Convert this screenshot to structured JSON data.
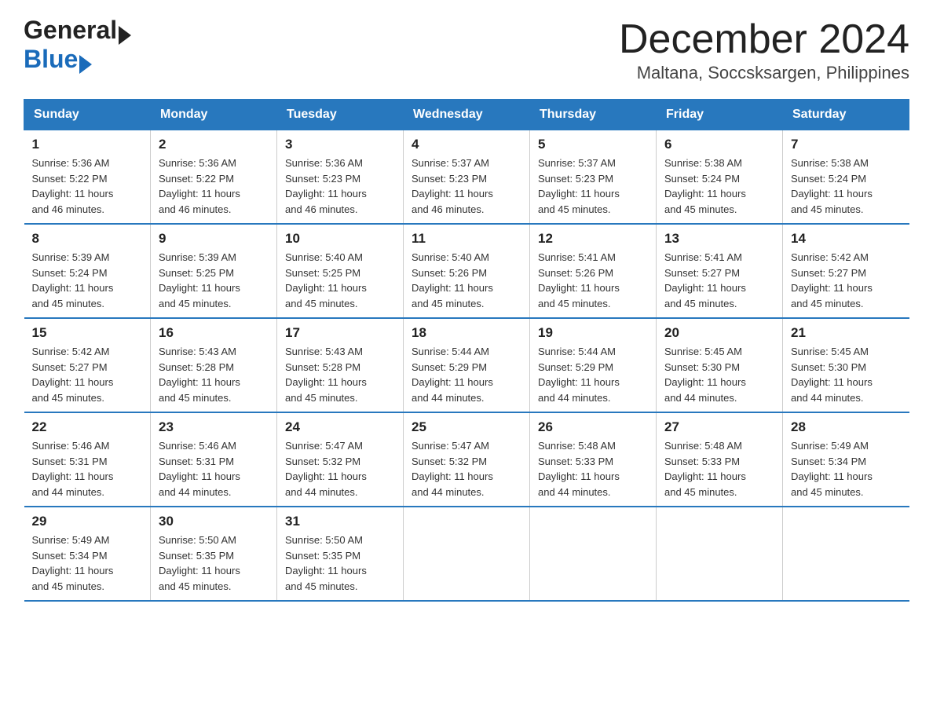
{
  "header": {
    "logo_general": "General",
    "logo_blue": "Blue",
    "month_title": "December 2024",
    "location": "Maltana, Soccsksargen, Philippines"
  },
  "days_of_week": [
    "Sunday",
    "Monday",
    "Tuesday",
    "Wednesday",
    "Thursday",
    "Friday",
    "Saturday"
  ],
  "weeks": [
    [
      {
        "day": "1",
        "sunrise": "5:36 AM",
        "sunset": "5:22 PM",
        "daylight": "11 hours and 46 minutes."
      },
      {
        "day": "2",
        "sunrise": "5:36 AM",
        "sunset": "5:22 PM",
        "daylight": "11 hours and 46 minutes."
      },
      {
        "day": "3",
        "sunrise": "5:36 AM",
        "sunset": "5:23 PM",
        "daylight": "11 hours and 46 minutes."
      },
      {
        "day": "4",
        "sunrise": "5:37 AM",
        "sunset": "5:23 PM",
        "daylight": "11 hours and 46 minutes."
      },
      {
        "day": "5",
        "sunrise": "5:37 AM",
        "sunset": "5:23 PM",
        "daylight": "11 hours and 45 minutes."
      },
      {
        "day": "6",
        "sunrise": "5:38 AM",
        "sunset": "5:24 PM",
        "daylight": "11 hours and 45 minutes."
      },
      {
        "day": "7",
        "sunrise": "5:38 AM",
        "sunset": "5:24 PM",
        "daylight": "11 hours and 45 minutes."
      }
    ],
    [
      {
        "day": "8",
        "sunrise": "5:39 AM",
        "sunset": "5:24 PM",
        "daylight": "11 hours and 45 minutes."
      },
      {
        "day": "9",
        "sunrise": "5:39 AM",
        "sunset": "5:25 PM",
        "daylight": "11 hours and 45 minutes."
      },
      {
        "day": "10",
        "sunrise": "5:40 AM",
        "sunset": "5:25 PM",
        "daylight": "11 hours and 45 minutes."
      },
      {
        "day": "11",
        "sunrise": "5:40 AM",
        "sunset": "5:26 PM",
        "daylight": "11 hours and 45 minutes."
      },
      {
        "day": "12",
        "sunrise": "5:41 AM",
        "sunset": "5:26 PM",
        "daylight": "11 hours and 45 minutes."
      },
      {
        "day": "13",
        "sunrise": "5:41 AM",
        "sunset": "5:27 PM",
        "daylight": "11 hours and 45 minutes."
      },
      {
        "day": "14",
        "sunrise": "5:42 AM",
        "sunset": "5:27 PM",
        "daylight": "11 hours and 45 minutes."
      }
    ],
    [
      {
        "day": "15",
        "sunrise": "5:42 AM",
        "sunset": "5:27 PM",
        "daylight": "11 hours and 45 minutes."
      },
      {
        "day": "16",
        "sunrise": "5:43 AM",
        "sunset": "5:28 PM",
        "daylight": "11 hours and 45 minutes."
      },
      {
        "day": "17",
        "sunrise": "5:43 AM",
        "sunset": "5:28 PM",
        "daylight": "11 hours and 45 minutes."
      },
      {
        "day": "18",
        "sunrise": "5:44 AM",
        "sunset": "5:29 PM",
        "daylight": "11 hours and 44 minutes."
      },
      {
        "day": "19",
        "sunrise": "5:44 AM",
        "sunset": "5:29 PM",
        "daylight": "11 hours and 44 minutes."
      },
      {
        "day": "20",
        "sunrise": "5:45 AM",
        "sunset": "5:30 PM",
        "daylight": "11 hours and 44 minutes."
      },
      {
        "day": "21",
        "sunrise": "5:45 AM",
        "sunset": "5:30 PM",
        "daylight": "11 hours and 44 minutes."
      }
    ],
    [
      {
        "day": "22",
        "sunrise": "5:46 AM",
        "sunset": "5:31 PM",
        "daylight": "11 hours and 44 minutes."
      },
      {
        "day": "23",
        "sunrise": "5:46 AM",
        "sunset": "5:31 PM",
        "daylight": "11 hours and 44 minutes."
      },
      {
        "day": "24",
        "sunrise": "5:47 AM",
        "sunset": "5:32 PM",
        "daylight": "11 hours and 44 minutes."
      },
      {
        "day": "25",
        "sunrise": "5:47 AM",
        "sunset": "5:32 PM",
        "daylight": "11 hours and 44 minutes."
      },
      {
        "day": "26",
        "sunrise": "5:48 AM",
        "sunset": "5:33 PM",
        "daylight": "11 hours and 44 minutes."
      },
      {
        "day": "27",
        "sunrise": "5:48 AM",
        "sunset": "5:33 PM",
        "daylight": "11 hours and 45 minutes."
      },
      {
        "day": "28",
        "sunrise": "5:49 AM",
        "sunset": "5:34 PM",
        "daylight": "11 hours and 45 minutes."
      }
    ],
    [
      {
        "day": "29",
        "sunrise": "5:49 AM",
        "sunset": "5:34 PM",
        "daylight": "11 hours and 45 minutes."
      },
      {
        "day": "30",
        "sunrise": "5:50 AM",
        "sunset": "5:35 PM",
        "daylight": "11 hours and 45 minutes."
      },
      {
        "day": "31",
        "sunrise": "5:50 AM",
        "sunset": "5:35 PM",
        "daylight": "11 hours and 45 minutes."
      },
      null,
      null,
      null,
      null
    ]
  ],
  "labels": {
    "sunrise": "Sunrise:",
    "sunset": "Sunset:",
    "daylight": "Daylight:"
  }
}
